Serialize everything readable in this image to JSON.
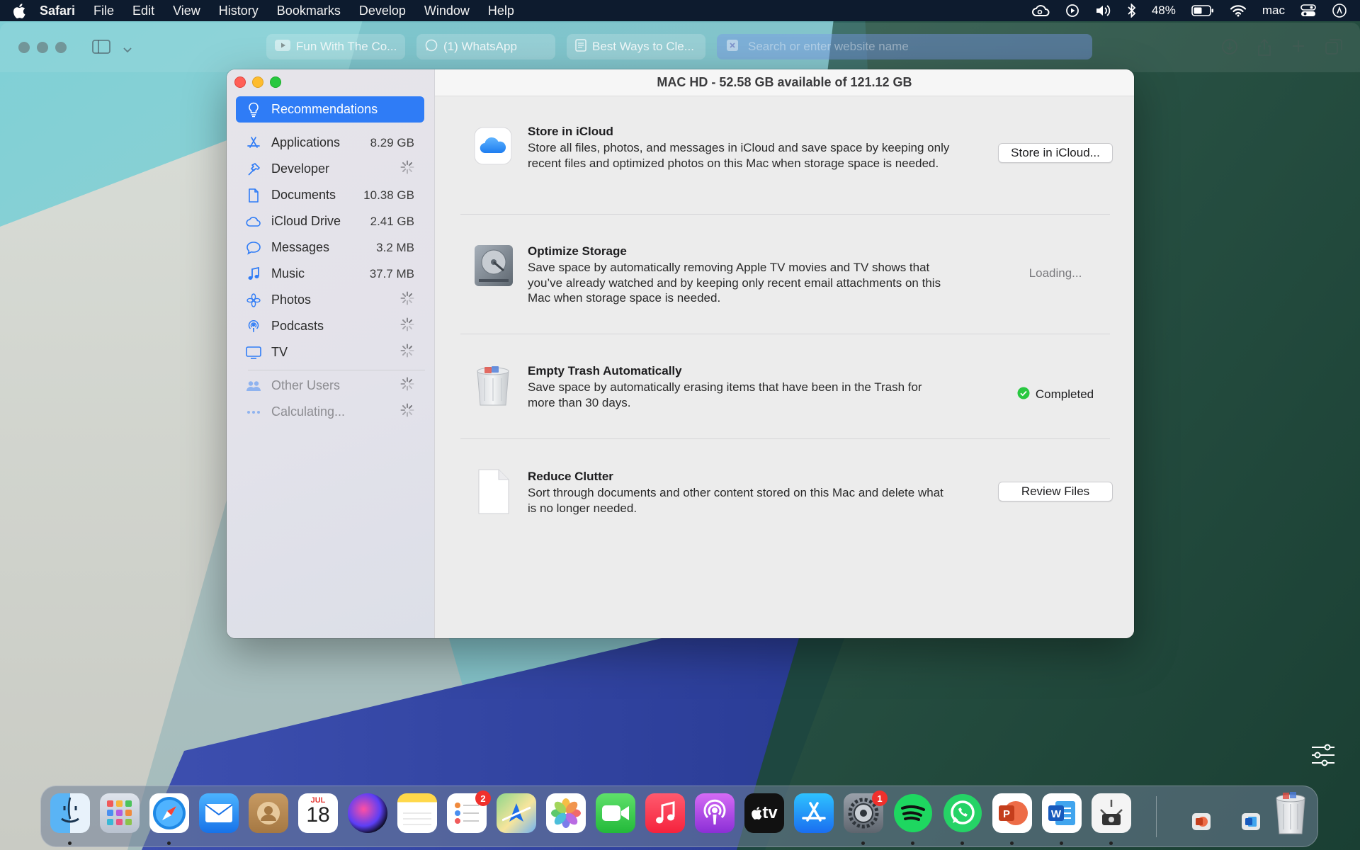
{
  "menubar": {
    "app": "Safari",
    "items": [
      "File",
      "Edit",
      "View",
      "History",
      "Bookmarks",
      "Develop",
      "Window",
      "Help"
    ],
    "battery": "48%",
    "user": "mac"
  },
  "safari": {
    "tabs": [
      "Fun With The Co...",
      "(1) WhatsApp",
      "Best Ways to Cle..."
    ],
    "url_placeholder": "Search or enter website name"
  },
  "storage": {
    "title": "MAC HD - 52.58 GB available of 121.12 GB",
    "sidebar": [
      {
        "label": "Recommendations",
        "size": "",
        "icon": "lightbulb-icon",
        "active": true
      },
      {
        "label": "Applications",
        "size": "8.29 GB",
        "icon": "app-store-a-icon"
      },
      {
        "label": "Developer",
        "size": "",
        "icon": "hammer-icon"
      },
      {
        "label": "Documents",
        "size": "10.38 GB",
        "icon": "document-icon"
      },
      {
        "label": "iCloud Drive",
        "size": "2.41 GB",
        "icon": "cloud-icon"
      },
      {
        "label": "Messages",
        "size": "3.2 MB",
        "icon": "speech-bubble-icon"
      },
      {
        "label": "Music",
        "size": "37.7 MB",
        "icon": "music-note-icon"
      },
      {
        "label": "Photos",
        "size": "",
        "icon": "photos-flower-icon"
      },
      {
        "label": "Podcasts",
        "size": "",
        "icon": "podcast-icon"
      },
      {
        "label": "TV",
        "size": "",
        "icon": "tv-icon"
      },
      {
        "label": "Other Users",
        "size": "",
        "icon": "users-icon"
      },
      {
        "label": "Calculating...",
        "size": "",
        "icon": "ellipsis-icon"
      }
    ],
    "recommendations": [
      {
        "title": "Store in iCloud",
        "desc": "Store all files, photos, and messages in iCloud and save space by keeping only recent files and optimized photos on this Mac when storage space is needed.",
        "action": "Store in iCloud..."
      },
      {
        "title": "Optimize Storage",
        "desc": "Save space by automatically removing Apple TV movies and TV shows that you’ve already watched and by keeping only recent email attachments on this Mac when storage space is needed.",
        "action": "Loading..."
      },
      {
        "title": "Empty Trash Automatically",
        "desc": "Save space by automatically erasing items that have been in the Trash for more than 30 days.",
        "action": "Completed"
      },
      {
        "title": "Reduce Clutter",
        "desc": "Sort through documents and other content stored on this Mac and delete what is no longer needed.",
        "action": "Review Files"
      }
    ]
  },
  "dock": {
    "calendar_month": "JUL",
    "calendar_day": "18",
    "reminders_badge": "2",
    "settings_badge": "1",
    "tv_label": "tv"
  },
  "colors": {
    "accent": "#2f7cf6",
    "menubar": "#0d1b2e",
    "badge": "#f0302c",
    "success": "#28c840"
  }
}
